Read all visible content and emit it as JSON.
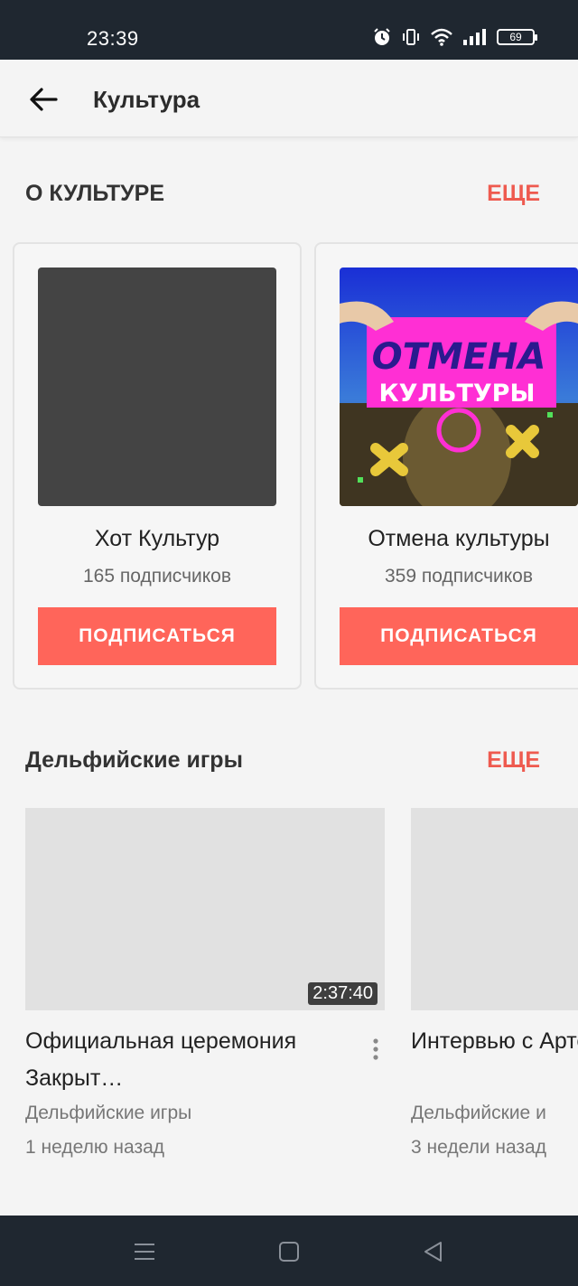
{
  "status_bar": {
    "time": "23:39",
    "battery": "69",
    "icons": [
      "alarm-icon",
      "vibrate-icon",
      "wifi-icon",
      "signal-icon",
      "battery-icon"
    ]
  },
  "app_bar": {
    "back_icon": "arrow-left-icon",
    "title": "Культура"
  },
  "section_about": {
    "title": "О КУЛЬТУРЕ",
    "more": "ЕЩЕ",
    "channels": [
      {
        "name": "Хот Культур",
        "subscribers": "165 подписчиков",
        "button": "ПОДПИСАТЬСЯ",
        "thumbnail": "dark-placeholder"
      },
      {
        "name": "Отмена культуры",
        "subscribers": "359 подписчиков",
        "button": "ПОДПИСАТЬСЯ",
        "thumbnail": "cover-art",
        "cover_line1": "ОТМЕНА",
        "cover_line2": "КУЛЬТУРЫ"
      }
    ]
  },
  "section_delphic": {
    "title": "Дельфийские игры",
    "more": "ЕЩЕ",
    "videos": [
      {
        "title": "Официальная церемония Закрыт…",
        "channel": "Дельфийские игры",
        "date": "1 неделю назад",
        "duration": "2:37:40"
      },
      {
        "title": "Интервью с Артемием По",
        "channel": "Дельфийские и",
        "date": "3 недели назад",
        "duration": ""
      }
    ]
  },
  "nav_bar": {
    "icons": [
      "menu-icon",
      "home-square-icon",
      "back-triangle-icon"
    ]
  },
  "colors": {
    "accent": "#ff655a",
    "more_link": "#ee5a4f",
    "status_bar": "#1f2730",
    "background": "#f4f4f4"
  }
}
